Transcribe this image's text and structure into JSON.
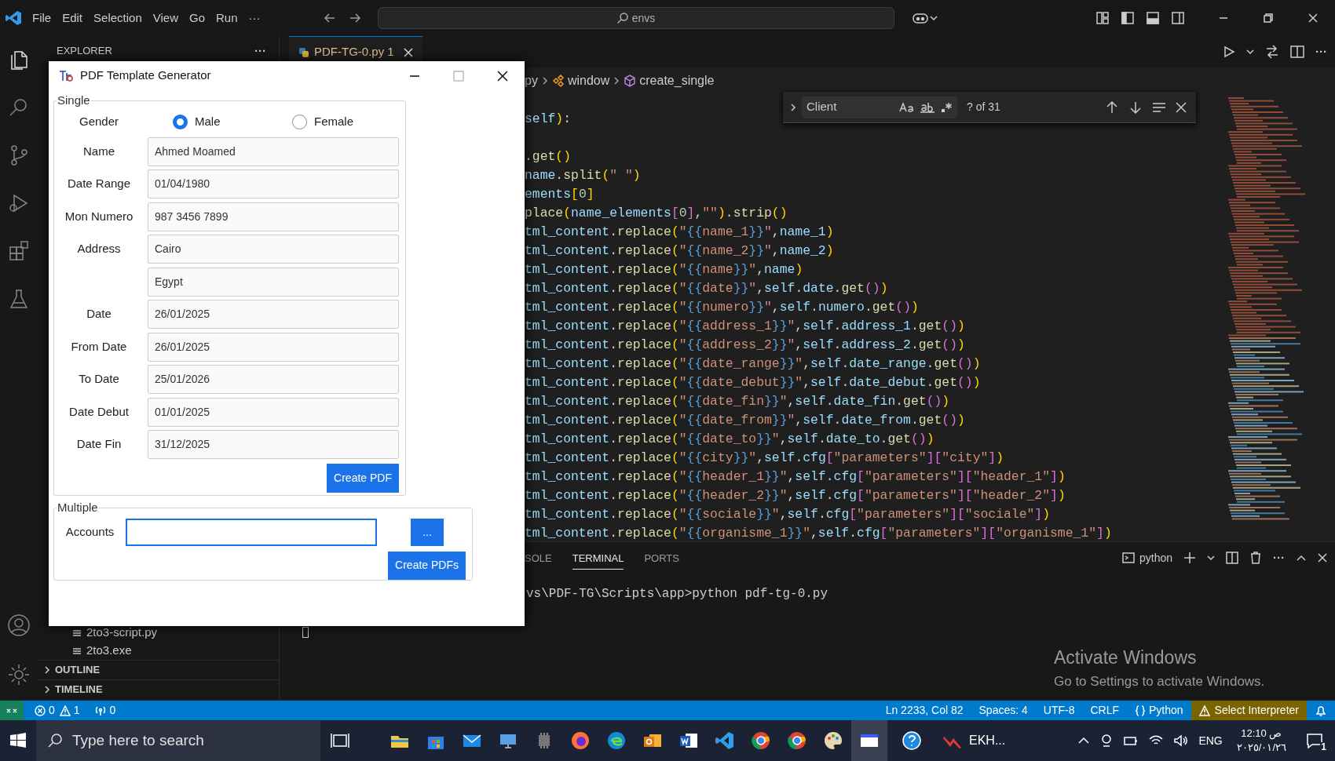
{
  "title_bar": {
    "menu": [
      "File",
      "Edit",
      "Selection",
      "View",
      "Go",
      "Run",
      "···"
    ],
    "search": "envs"
  },
  "sidebar": {
    "title": "EXPLORER",
    "more": "···",
    "files": [
      {
        "name": "2to3-script.py"
      },
      {
        "name": "2to3.exe"
      }
    ],
    "sections": [
      {
        "label": "OUTLINE",
        "expanded": false
      },
      {
        "label": "TIMELINE",
        "expanded": false
      }
    ]
  },
  "editor": {
    "tabs": [
      {
        "label": "PDF-TG-0.py",
        "badge": "1",
        "selected": true
      }
    ],
    "breadcrumb": [
      "py",
      "window",
      "create_single"
    ],
    "find": {
      "value": "Client",
      "result": "? of 31"
    },
    "code_blocks": [
      [
        "self):"
      ],
      [
        ".get()",
        "name.split(\" \")",
        "ements[0]",
        "place(name_elements[0],\"\").strip()",
        "tml_content.replace(\"{{name_1}}\",name_1)",
        "tml_content.replace(\"{{name_2}}\",name_2)",
        "tml_content.replace(\"{{name}}\",name)",
        "tml_content.replace(\"{{date}}\",self.date.get())",
        "tml_content.replace(\"{{numero}}\",self.numero.get())",
        "tml_content.replace(\"{{address_1}}\",self.address_1.get())",
        "tml_content.replace(\"{{address_2}}\",self.address_2.get())",
        "tml_content.replace(\"{{date_range}}\",self.date_range.get())",
        "tml_content.replace(\"{{date_debut}}\",self.date_debut.get())",
        "tml_content.replace(\"{{date_fin}}\",self.date_fin.get())",
        "tml_content.replace(\"{{date_from}}\",self.date_from.get())",
        "tml_content.replace(\"{{date_to}}\",self.date_to.get())",
        "tml_content.replace(\"{{city}}\",self.cfg[\"parameters\"][\"city\"])",
        "tml_content.replace(\"{{header_1}}\",self.cfg[\"parameters\"][\"header_1\"])",
        "tml_content.replace(\"{{header_2}}\",self.cfg[\"parameters\"][\"header_2\"])",
        "tml_content.replace(\"{{sociale}}\",self.cfg[\"parameters\"][\"sociale\"])",
        "tml_content.replace(\"{{organisme_1}}\",self.cfg[\"parameters\"][\"organisme_1\"])"
      ]
    ]
  },
  "panel": {
    "tabs": [
      {
        "label": "SOLE",
        "selected": false
      },
      {
        "label": "TERMINAL",
        "selected": true
      },
      {
        "label": "PORTS",
        "selected": false
      }
    ],
    "terminal_name": "python",
    "terminal_lines": [
      "vs\\PDF-TG\\Scripts\\app>python pdf-tg-0.py"
    ]
  },
  "activation": {
    "title": "Activate Windows",
    "text": "Go to Settings to activate Windows."
  },
  "dialog": {
    "title": "PDF Template Generator",
    "single": {
      "legend": "Single",
      "gender_label": "Gender",
      "options": [
        {
          "label": "Male",
          "selected": true
        },
        {
          "label": "Female",
          "selected": false
        }
      ],
      "fields": [
        {
          "label": "Name",
          "value": "Ahmed Moamed"
        },
        {
          "label": "Date Range",
          "value": "01/04/1980"
        },
        {
          "label": "Mon Numero",
          "value": "987 3456 7899"
        },
        {
          "label": "Address",
          "value": "Cairo"
        },
        {
          "value": "Egypt"
        },
        {
          "label": "Date",
          "value": "26/01/2025"
        },
        {
          "label": "From Date",
          "value": "26/01/2025"
        },
        {
          "label": "To Date",
          "value": "25/01/2026"
        },
        {
          "label": "Date Debut",
          "value": "01/01/2025"
        },
        {
          "label": "Date Fin",
          "value": "31/12/2025"
        }
      ],
      "button": "Create PDF"
    },
    "multiple": {
      "legend": "Multiple",
      "label": "Accounts",
      "focused": true,
      "browse": "...",
      "button": "Create PDFs"
    }
  },
  "status_bar": {
    "errors": "0",
    "warnings": "1",
    "ports": "0",
    "items": [
      "Ln 2233, Col 82",
      "Spaces: 4",
      "UTF-8",
      "CRLF"
    ],
    "language": "Python",
    "interpreter": "Select Interpreter"
  },
  "taskbar": {
    "search_placeholder": "Type here to search",
    "running_app": "EKH...",
    "language": "ENG",
    "time": "12:10 ص",
    "date": "٢٠٢٥/٠١/٢٦",
    "notifications": "1"
  }
}
